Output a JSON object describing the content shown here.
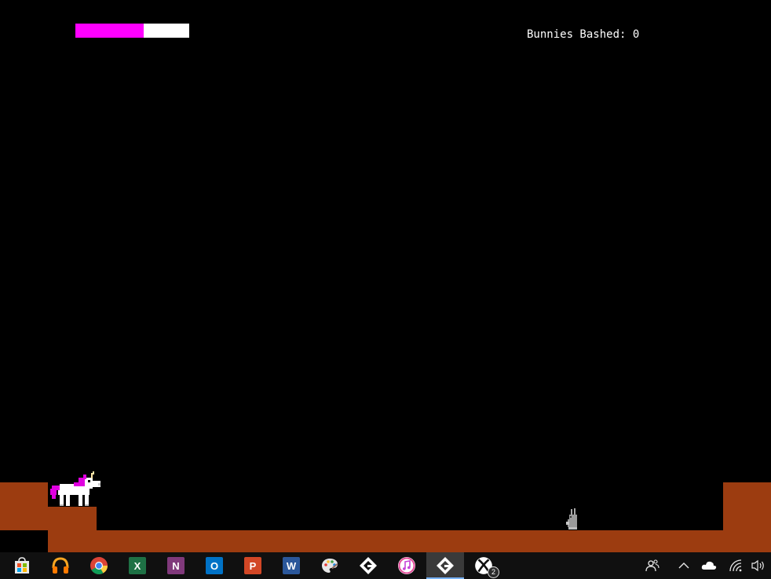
{
  "game": {
    "health_percent": 60,
    "colors": {
      "health_fill": "#ff00ff",
      "health_empty": "#ffffff",
      "background": "#000000",
      "ground": "#9c3c10",
      "unicorn_body": "#ffffff",
      "unicorn_mane": "#e000e0",
      "bunny": "#9a9a9a"
    },
    "score_label": "Bunnies Bashed: 0"
  },
  "taskbar": {
    "apps": [
      {
        "name": "store",
        "icon": "store-icon"
      },
      {
        "name": "headphones-app",
        "icon": "headphones-icon"
      },
      {
        "name": "chrome",
        "icon": "chrome-icon"
      },
      {
        "name": "excel",
        "icon": "excel-icon",
        "letter": "X",
        "color": "#1e7145"
      },
      {
        "name": "onenote",
        "icon": "onenote-icon",
        "letter": "N",
        "color": "#80397b"
      },
      {
        "name": "outlook",
        "icon": "outlook-icon",
        "letter": "O",
        "color": "#0072c6"
      },
      {
        "name": "powerpoint",
        "icon": "powerpoint-icon",
        "letter": "P",
        "color": "#d24726"
      },
      {
        "name": "word",
        "icon": "word-icon",
        "letter": "W",
        "color": "#2b579a"
      },
      {
        "name": "paint",
        "icon": "paint-palette-icon"
      },
      {
        "name": "gamemaker",
        "icon": "gamemaker-icon"
      },
      {
        "name": "itunes",
        "icon": "itunes-icon"
      },
      {
        "name": "gamemaker-running",
        "icon": "gamemaker-icon",
        "active": true
      },
      {
        "name": "xbox",
        "icon": "xbox-icon",
        "badge": "2"
      }
    ],
    "tray": [
      {
        "name": "people",
        "icon": "people-icon"
      },
      {
        "name": "show-hidden",
        "icon": "chevron-up-icon"
      },
      {
        "name": "onedrive",
        "icon": "cloud-icon"
      },
      {
        "name": "network",
        "icon": "wifi-icon"
      },
      {
        "name": "volume",
        "icon": "speaker-icon"
      }
    ],
    "xbox_badge": "2"
  }
}
